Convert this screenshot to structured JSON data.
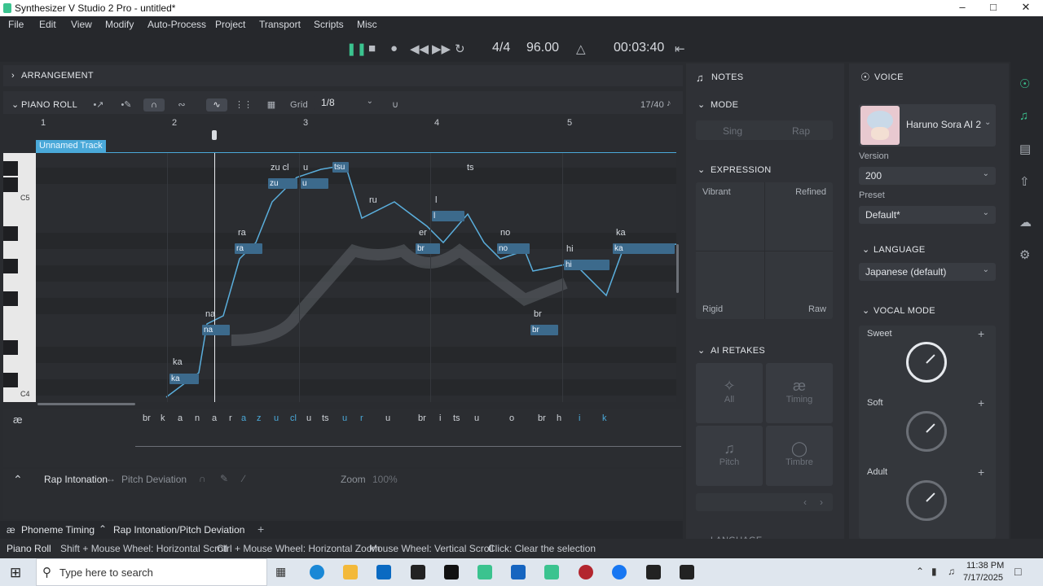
{
  "window": {
    "title": "Synthesizer V Studio 2 Pro - untitled*"
  },
  "menu": [
    "File",
    "Edit",
    "View",
    "Modify",
    "Auto-Process",
    "Project",
    "Transport",
    "Scripts",
    "Misc"
  ],
  "transport": {
    "time_signature": "4/4",
    "tempo": "96.00",
    "time": "00:03:40"
  },
  "arrangement": {
    "label": "ARRANGEMENT"
  },
  "piano_roll": {
    "label": "PIANO ROLL",
    "grid_label": "Grid",
    "grid_value": "1/8",
    "counter": "17/40",
    "track_name": "Unnamed Track",
    "measures": [
      "1",
      "2",
      "3",
      "4",
      "5"
    ],
    "keys": [
      "C5",
      "C4"
    ],
    "lyrics": [
      "ka",
      "na",
      "ra",
      "zu cl",
      "u",
      "ts",
      "ru",
      "l",
      "er",
      "no",
      "hi",
      "ka",
      "br"
    ],
    "notes": [
      "ka",
      "na",
      "ra",
      "zu",
      "u",
      "tsu",
      "l",
      "br",
      "no",
      "br",
      "hi",
      "ka"
    ]
  },
  "phonemes": {
    "icon": "æ",
    "items": [
      "br",
      "k",
      "a",
      "n",
      "a",
      "r",
      "a",
      "z",
      "u",
      "cl",
      "u",
      "ts",
      "u",
      "r",
      "u",
      "br",
      "i",
      "ts",
      "u",
      "o",
      "br",
      "h",
      "i",
      "k"
    ]
  },
  "param_panel": {
    "rap_intonation": "Rap Intonation",
    "pitch_deviation": "Pitch Deviation",
    "zoom_label": "Zoom",
    "zoom_value": "100%"
  },
  "bottom_tabs": {
    "tab1": "Phoneme Timing",
    "tab2": "Rap Intonation/Pitch Deviation"
  },
  "notes_panel": {
    "title": "NOTES",
    "mode_label": "MODE",
    "mode_sing": "Sing",
    "mode_rap": "Rap",
    "expression_label": "EXPRESSION",
    "expr_vibrant": "Vibrant",
    "expr_refined": "Refined",
    "expr_rigid": "Rigid",
    "expr_raw": "Raw",
    "ai_retakes_label": "AI RETAKES",
    "retake_all": "All",
    "retake_timing": "Timing",
    "retake_pitch": "Pitch",
    "retake_timbre": "Timbre",
    "language_label": "LANGUAGE"
  },
  "voice_panel": {
    "title": "VOICE",
    "voice_name": "Haruno Sora AI 2",
    "version_label": "Version",
    "version_value": "200",
    "preset_label": "Preset",
    "preset_value": "Default*",
    "language_label": "LANGUAGE",
    "language_value": "Japanese (default)",
    "vocal_mode_label": "VOCAL MODE",
    "modes": [
      {
        "name": "Sweet"
      },
      {
        "name": "Soft"
      },
      {
        "name": "Adult"
      }
    ]
  },
  "status_bar": {
    "context": "Piano Roll",
    "hint1": "Shift + Mouse Wheel: Horizontal Scroll",
    "hint2": "Ctrl + Mouse Wheel: Horizontal Zoom",
    "hint3": "Mouse Wheel: Vertical Scroll",
    "hint4": "Click: Clear the selection"
  },
  "taskbar": {
    "search_placeholder": "Type here to search",
    "time": "11:38 PM",
    "date": "7/17/2025"
  },
  "colors": {
    "accent": "#4aa9d9",
    "green": "#3bc38f",
    "background": "#2a2c30"
  }
}
